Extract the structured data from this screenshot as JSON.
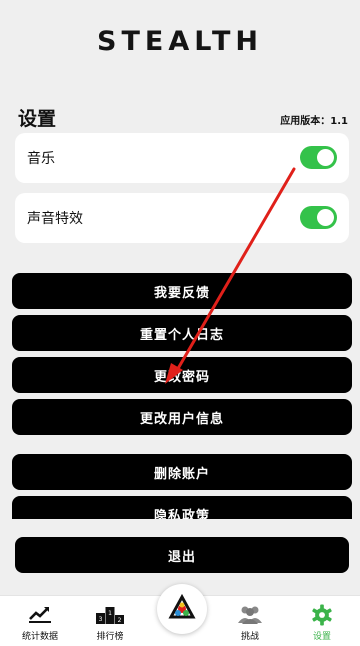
{
  "brand": {
    "logo_text": "STEALTH"
  },
  "settings": {
    "title": "设置",
    "version": "应用版本：1.1",
    "toggles": [
      {
        "label": "音乐",
        "on": true
      },
      {
        "label": "声音特效",
        "on": true
      }
    ],
    "menu": [
      {
        "label": "我要反馈"
      },
      {
        "label": "重置个人日志"
      },
      {
        "label": "更改密码"
      },
      {
        "label": "更改用户信息"
      },
      {
        "label": "删除账户"
      },
      {
        "label": "隐私政策"
      }
    ],
    "logout_label": "退出"
  },
  "tabs": [
    {
      "label": "统计数据",
      "icon": "stats-icon"
    },
    {
      "label": "排行榜",
      "icon": "leaderboard-icon"
    },
    {
      "label": "",
      "icon": "home-logo-icon"
    },
    {
      "label": "挑战",
      "icon": "group-icon"
    },
    {
      "label": "设置",
      "icon": "gear-icon",
      "active": true
    }
  ],
  "colors": {
    "toggle_on": "#34c24a",
    "button_bg": "#000000",
    "active_tab": "#3bb34a",
    "annotation": "#e0201a"
  }
}
